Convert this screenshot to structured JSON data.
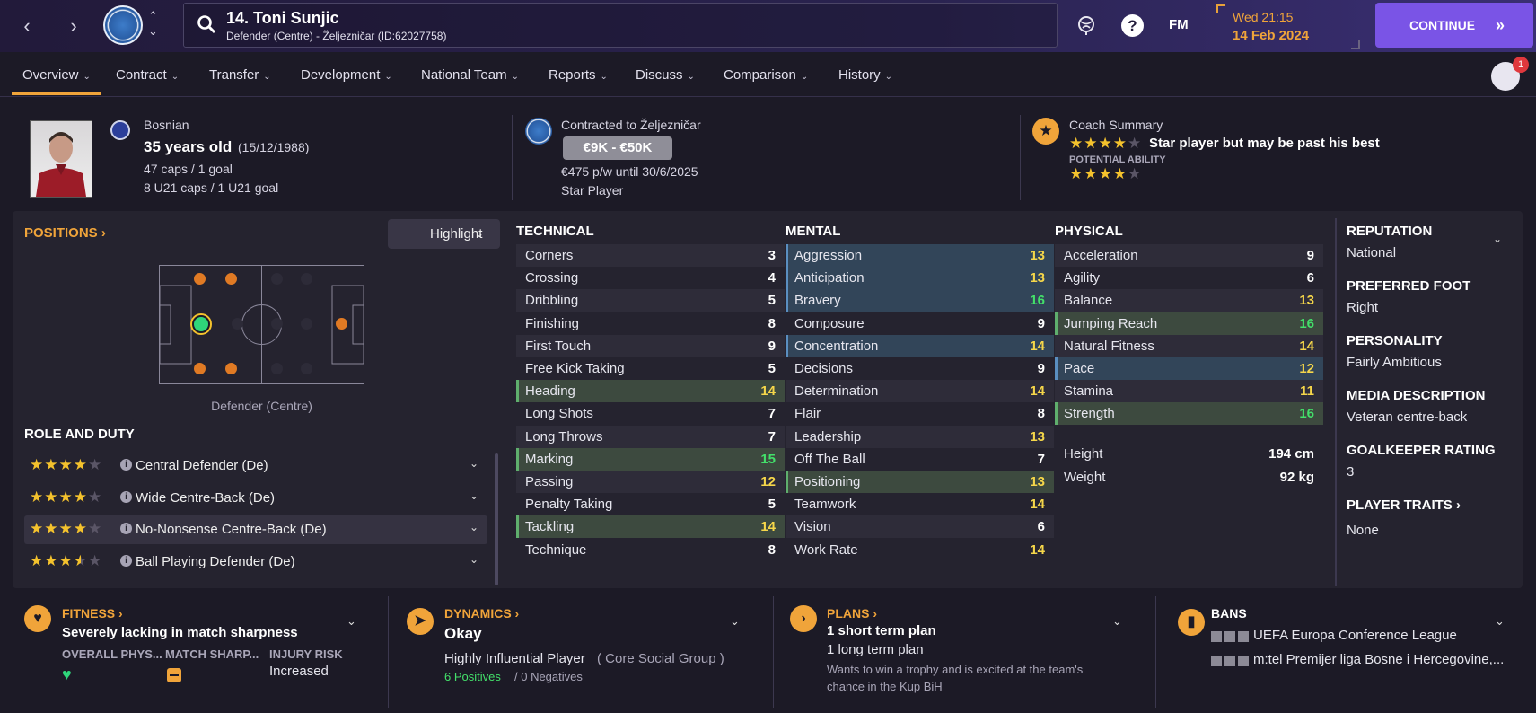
{
  "header": {
    "player_name": "14. Toni Sunjic",
    "player_subtitle": "Defender (Centre) - Željezničar (ID:62027758)",
    "time": "Wed 21:15",
    "date": "14 Feb 2024",
    "continue_label": "CONTINUE",
    "fm_label": "FM",
    "help_label": "?",
    "social_badge": "1"
  },
  "tabs": [
    {
      "label": "Overview"
    },
    {
      "label": "Contract"
    },
    {
      "label": "Transfer"
    },
    {
      "label": "Development"
    },
    {
      "label": "National Team"
    },
    {
      "label": "Reports"
    },
    {
      "label": "Discuss"
    },
    {
      "label": "Comparison"
    },
    {
      "label": "History"
    }
  ],
  "summary": {
    "nationality": "Bosnian",
    "age": "35 years old",
    "dob": "(15/12/1988)",
    "caps": "47 caps / 1 goal",
    "u21_caps": "8 U21 caps / 1 U21 goal",
    "contracted_to": "Contracted to Željezničar",
    "value_range": "€9K - €50K",
    "wage": "€475 p/w until 30/6/2025",
    "squad_status": "Star Player",
    "coach_summary_label": "Coach Summary",
    "coach_summary_text": "Star player but may be past his best",
    "current_ability_stars": 4,
    "potential_ability_label": "POTENTIAL ABILITY",
    "potential_ability_stars": 4
  },
  "positions": {
    "title": "POSITIONS",
    "highlight_label": "Highlight",
    "caption": "Defender (Centre)"
  },
  "roles": {
    "title": "ROLE AND DUTY",
    "items": [
      {
        "name": "Central Defender (De)",
        "stars": 4
      },
      {
        "name": "Wide Centre-Back (De)",
        "stars": 4
      },
      {
        "name": "No-Nonsense Centre-Back (De)",
        "stars": 4
      },
      {
        "name": "Ball Playing Defender (De)",
        "stars": 3.5
      }
    ]
  },
  "technical": {
    "title": "TECHNICAL",
    "attrs": [
      {
        "name": "Corners",
        "value": "3"
      },
      {
        "name": "Crossing",
        "value": "4"
      },
      {
        "name": "Dribbling",
        "value": "5"
      },
      {
        "name": "Finishing",
        "value": "8"
      },
      {
        "name": "First Touch",
        "value": "9"
      },
      {
        "name": "Free Kick Taking",
        "value": "5"
      },
      {
        "name": "Heading",
        "value": "14"
      },
      {
        "name": "Long Shots",
        "value": "7"
      },
      {
        "name": "Long Throws",
        "value": "7"
      },
      {
        "name": "Marking",
        "value": "15"
      },
      {
        "name": "Passing",
        "value": "12"
      },
      {
        "name": "Penalty Taking",
        "value": "5"
      },
      {
        "name": "Tackling",
        "value": "14"
      },
      {
        "name": "Technique",
        "value": "8"
      }
    ]
  },
  "mental": {
    "title": "MENTAL",
    "attrs": [
      {
        "name": "Aggression",
        "value": "13"
      },
      {
        "name": "Anticipation",
        "value": "13"
      },
      {
        "name": "Bravery",
        "value": "16"
      },
      {
        "name": "Composure",
        "value": "9"
      },
      {
        "name": "Concentration",
        "value": "14"
      },
      {
        "name": "Decisions",
        "value": "9"
      },
      {
        "name": "Determination",
        "value": "14"
      },
      {
        "name": "Flair",
        "value": "8"
      },
      {
        "name": "Leadership",
        "value": "13"
      },
      {
        "name": "Off The Ball",
        "value": "7"
      },
      {
        "name": "Positioning",
        "value": "13"
      },
      {
        "name": "Teamwork",
        "value": "14"
      },
      {
        "name": "Vision",
        "value": "6"
      },
      {
        "name": "Work Rate",
        "value": "14"
      }
    ]
  },
  "physical": {
    "title": "PHYSICAL",
    "attrs": [
      {
        "name": "Acceleration",
        "value": "9"
      },
      {
        "name": "Agility",
        "value": "6"
      },
      {
        "name": "Balance",
        "value": "13"
      },
      {
        "name": "Jumping Reach",
        "value": "16"
      },
      {
        "name": "Natural Fitness",
        "value": "14"
      },
      {
        "name": "Pace",
        "value": "12"
      },
      {
        "name": "Stamina",
        "value": "11"
      },
      {
        "name": "Strength",
        "value": "16"
      }
    ],
    "height_label": "Height",
    "height": "194 cm",
    "weight_label": "Weight",
    "weight": "92 kg"
  },
  "info": {
    "reputation_label": "REPUTATION",
    "reputation": "National",
    "foot_label": "PREFERRED FOOT",
    "foot": "Right",
    "personality_label": "PERSONALITY",
    "personality": "Fairly Ambitious",
    "media_label": "MEDIA DESCRIPTION",
    "media": "Veteran centre-back",
    "gk_label": "GOALKEEPER RATING",
    "gk": "3",
    "traits_label": "PLAYER TRAITS",
    "traits": "None"
  },
  "bottom": {
    "fitness_title": "FITNESS",
    "fitness_main": "Severely lacking in match sharpness",
    "overall_phys_label": "OVERALL PHYS...",
    "match_sharp_label": "MATCH SHARP...",
    "injury_risk_label": "INJURY RISK",
    "injury_risk": "Increased",
    "dynamics_title": "DYNAMICS",
    "dynamics_main": "Okay",
    "dynamics_role": "Highly Influential Player",
    "dynamics_group": "( Core Social Group )",
    "positives": "6 Positives",
    "negatives": "/ 0 Negatives",
    "plans_title": "PLANS",
    "plans_short": "1 short term plan",
    "plans_long": "1 long term plan",
    "plans_note": "Wants to win a trophy and is excited at the team's chance in the Kup BiH",
    "bans_title": "BANS",
    "ban1": "UEFA Europa Conference League",
    "ban2": "m:tel Premijer liga Bosne i Hercegovine,..."
  },
  "colors": {
    "accent": "#f0a43a",
    "continue": "#7a54e6",
    "good": "#43e06a",
    "mid": "#f5d64a"
  }
}
